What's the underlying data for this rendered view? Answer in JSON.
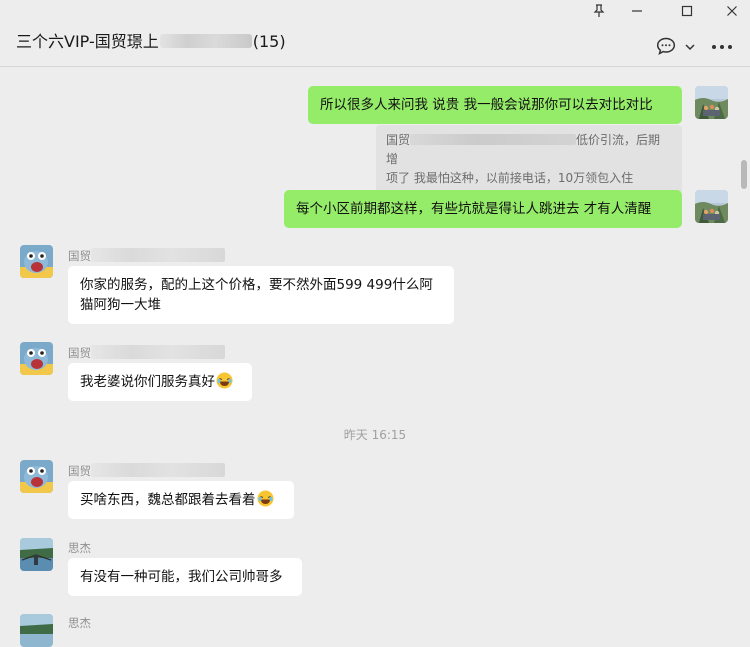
{
  "window": {
    "title_prefix": "三个六VIP-国贸璟上",
    "title_suffix": "(15)",
    "pin_glyph": "⚲",
    "minimize_glyph": "—",
    "maximize_glyph": "☐",
    "close_glyph": "✕",
    "more_glyph": "•••"
  },
  "messages": [
    {
      "from": "me",
      "text": "所以很多人来问我 说贵  我一般会说那你可以去对比对比"
    },
    {
      "type": "quote",
      "prefix": "国贸",
      "text1_tail": "低价引流，后期增",
      "text2": "项了   我最怕这种，以前接电话，10万领包入住"
    },
    {
      "from": "me",
      "text": "每个小区前期都这样，有些坑就是得让人跳进去   才有人清醒"
    },
    {
      "from": "other",
      "sender": "国贸",
      "text": "你家的服务，配的上这个价格，要不然外面599 499什么阿猫阿狗一大堆"
    },
    {
      "from": "other",
      "sender": "国贸",
      "text": "我老婆说你们服务真好"
    },
    {
      "type": "time",
      "text": "昨天 16:15"
    },
    {
      "from": "other",
      "sender": "国贸",
      "text": "买啥东西，魏总都跟着去看着"
    },
    {
      "from": "other",
      "sender": "思杰",
      "text": "有没有一种可能，我们公司帅哥多"
    },
    {
      "from": "other",
      "sender": "思杰"
    }
  ],
  "colors": {
    "self_bubble": "#95ec69",
    "other_bubble": "#ffffff",
    "background": "#ededed"
  },
  "icons": [
    "pin-icon",
    "minimize-icon",
    "maximize-icon",
    "close-icon",
    "chat-bubble-icon",
    "chevron-down-icon",
    "more-icon",
    "laugh-cry-emoji"
  ]
}
